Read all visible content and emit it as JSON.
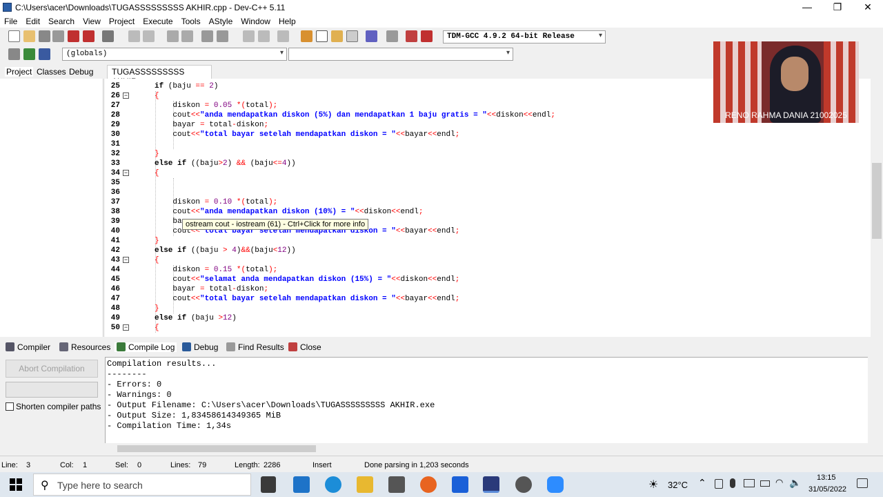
{
  "window": {
    "title": "C:\\Users\\acer\\Downloads\\TUGASSSSSSSSS AKHIR.cpp - Dev-C++ 5.11",
    "minimize": "—",
    "maximize": "❐",
    "close": "✕"
  },
  "menu": [
    "File",
    "Edit",
    "Search",
    "View",
    "Project",
    "Execute",
    "Tools",
    "AStyle",
    "Window",
    "Help"
  ],
  "toolbar": {
    "compiler_select": "TDM-GCC 4.9.2 64-bit Release",
    "scope_select": "(globals)"
  },
  "left_tabs": [
    "Project",
    "Classes",
    "Debug"
  ],
  "editor": {
    "file_tab": "TUGASSSSSSSSS AKHIR.cpp",
    "tooltip": "ostream cout - iostream (61) - Ctrl+Click for more info",
    "lines": [
      {
        "n": "25",
        "fold": ""
      },
      {
        "n": "26",
        "fold": "⊟"
      },
      {
        "n": "27",
        "fold": ""
      },
      {
        "n": "28",
        "fold": ""
      },
      {
        "n": "29",
        "fold": ""
      },
      {
        "n": "30",
        "fold": ""
      },
      {
        "n": "31",
        "fold": ""
      },
      {
        "n": "32",
        "fold": ""
      },
      {
        "n": "33",
        "fold": ""
      },
      {
        "n": "34",
        "fold": "⊟"
      },
      {
        "n": "35",
        "fold": ""
      },
      {
        "n": "36",
        "fold": ""
      },
      {
        "n": "37",
        "fold": ""
      },
      {
        "n": "38",
        "fold": ""
      },
      {
        "n": "39",
        "fold": ""
      },
      {
        "n": "40",
        "fold": ""
      },
      {
        "n": "41",
        "fold": ""
      },
      {
        "n": "42",
        "fold": ""
      },
      {
        "n": "43",
        "fold": "⊟"
      },
      {
        "n": "44",
        "fold": ""
      },
      {
        "n": "45",
        "fold": ""
      },
      {
        "n": "46",
        "fold": ""
      },
      {
        "n": "47",
        "fold": ""
      },
      {
        "n": "48",
        "fold": ""
      },
      {
        "n": "49",
        "fold": ""
      },
      {
        "n": "50",
        "fold": "⊟"
      }
    ]
  },
  "bottom_tabs": [
    "Compiler",
    "Resources",
    "Compile Log",
    "Debug",
    "Find Results",
    "Close"
  ],
  "bottom_panel": {
    "abort_label": "Abort Compilation",
    "shorten_label": "Shorten compiler paths",
    "log": [
      "Compilation results...",
      "--------",
      "- Errors: 0",
      "- Warnings: 0",
      "- Output Filename: C:\\Users\\acer\\Downloads\\TUGASSSSSSSSS AKHIR.exe",
      "- Output Size: 1,83458614349365 MiB",
      "- Compilation Time: 1,34s"
    ]
  },
  "status": {
    "line_label": "Line:",
    "line_value": "3",
    "col_label": "Col:",
    "col_value": "1",
    "sel_label": "Sel:",
    "sel_value": "0",
    "lines_label": "Lines:",
    "lines_value": "79",
    "length_label": "Length:",
    "length_value": "2286",
    "mode": "Insert",
    "message": "Done parsing in 1,203 seconds"
  },
  "webcam": {
    "name": "RENO RAHMA DANIA 21002025"
  },
  "taskbar": {
    "search_placeholder": "Type here to search",
    "temperature": "32°C",
    "time": "13:15",
    "date": "31/05/2022"
  },
  "colors": {
    "keyword": "#000000",
    "string": "#0000ff",
    "number": "#800080",
    "symbol": "#ff0000"
  }
}
